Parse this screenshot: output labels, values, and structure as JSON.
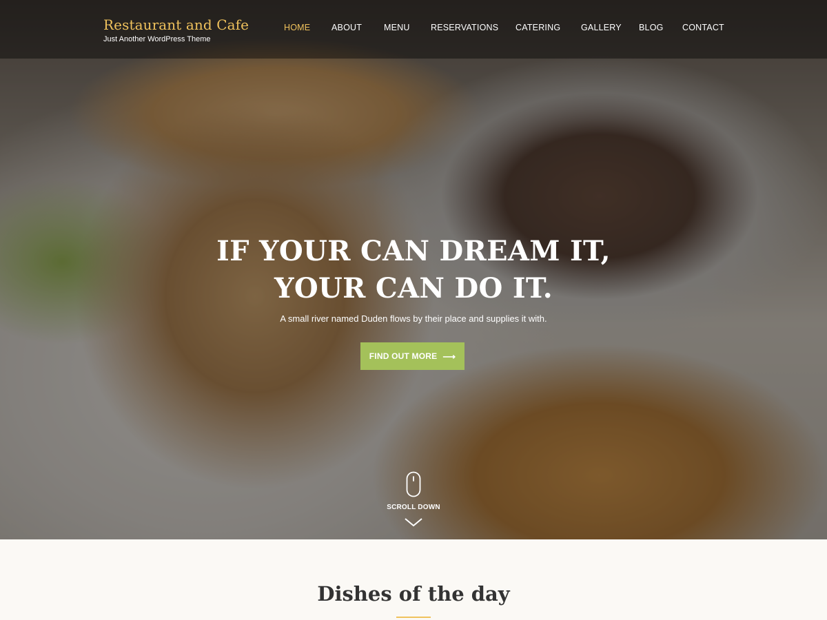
{
  "brand": {
    "title": "Restaurant and Cafe",
    "tagline": "Just Another WordPress Theme"
  },
  "nav": {
    "items": [
      "HOME",
      "ABOUT",
      "MENU",
      "RESERVATIONS",
      "CATERING",
      "GALLERY",
      "BLOG",
      "CONTACT"
    ],
    "active": "HOME"
  },
  "hero": {
    "title_line1": "IF YOUR CAN DREAM IT,",
    "title_line2": "YOUR CAN DO IT.",
    "subtitle": "A small river named Duden flows by their place and supplies it with.",
    "cta_label": "FIND OUT MORE",
    "cta_icon": "arrow-right-icon",
    "scroll_label": "SCROLL DOWN",
    "scroll_icons": [
      "mouse-icon",
      "chevron-down-icon"
    ]
  },
  "section": {
    "title": "Dishes of the day"
  },
  "colors": {
    "accent_gold": "#f0c25c",
    "cta_green": "#a4c15a",
    "section_bg": "#fbf9f5"
  }
}
